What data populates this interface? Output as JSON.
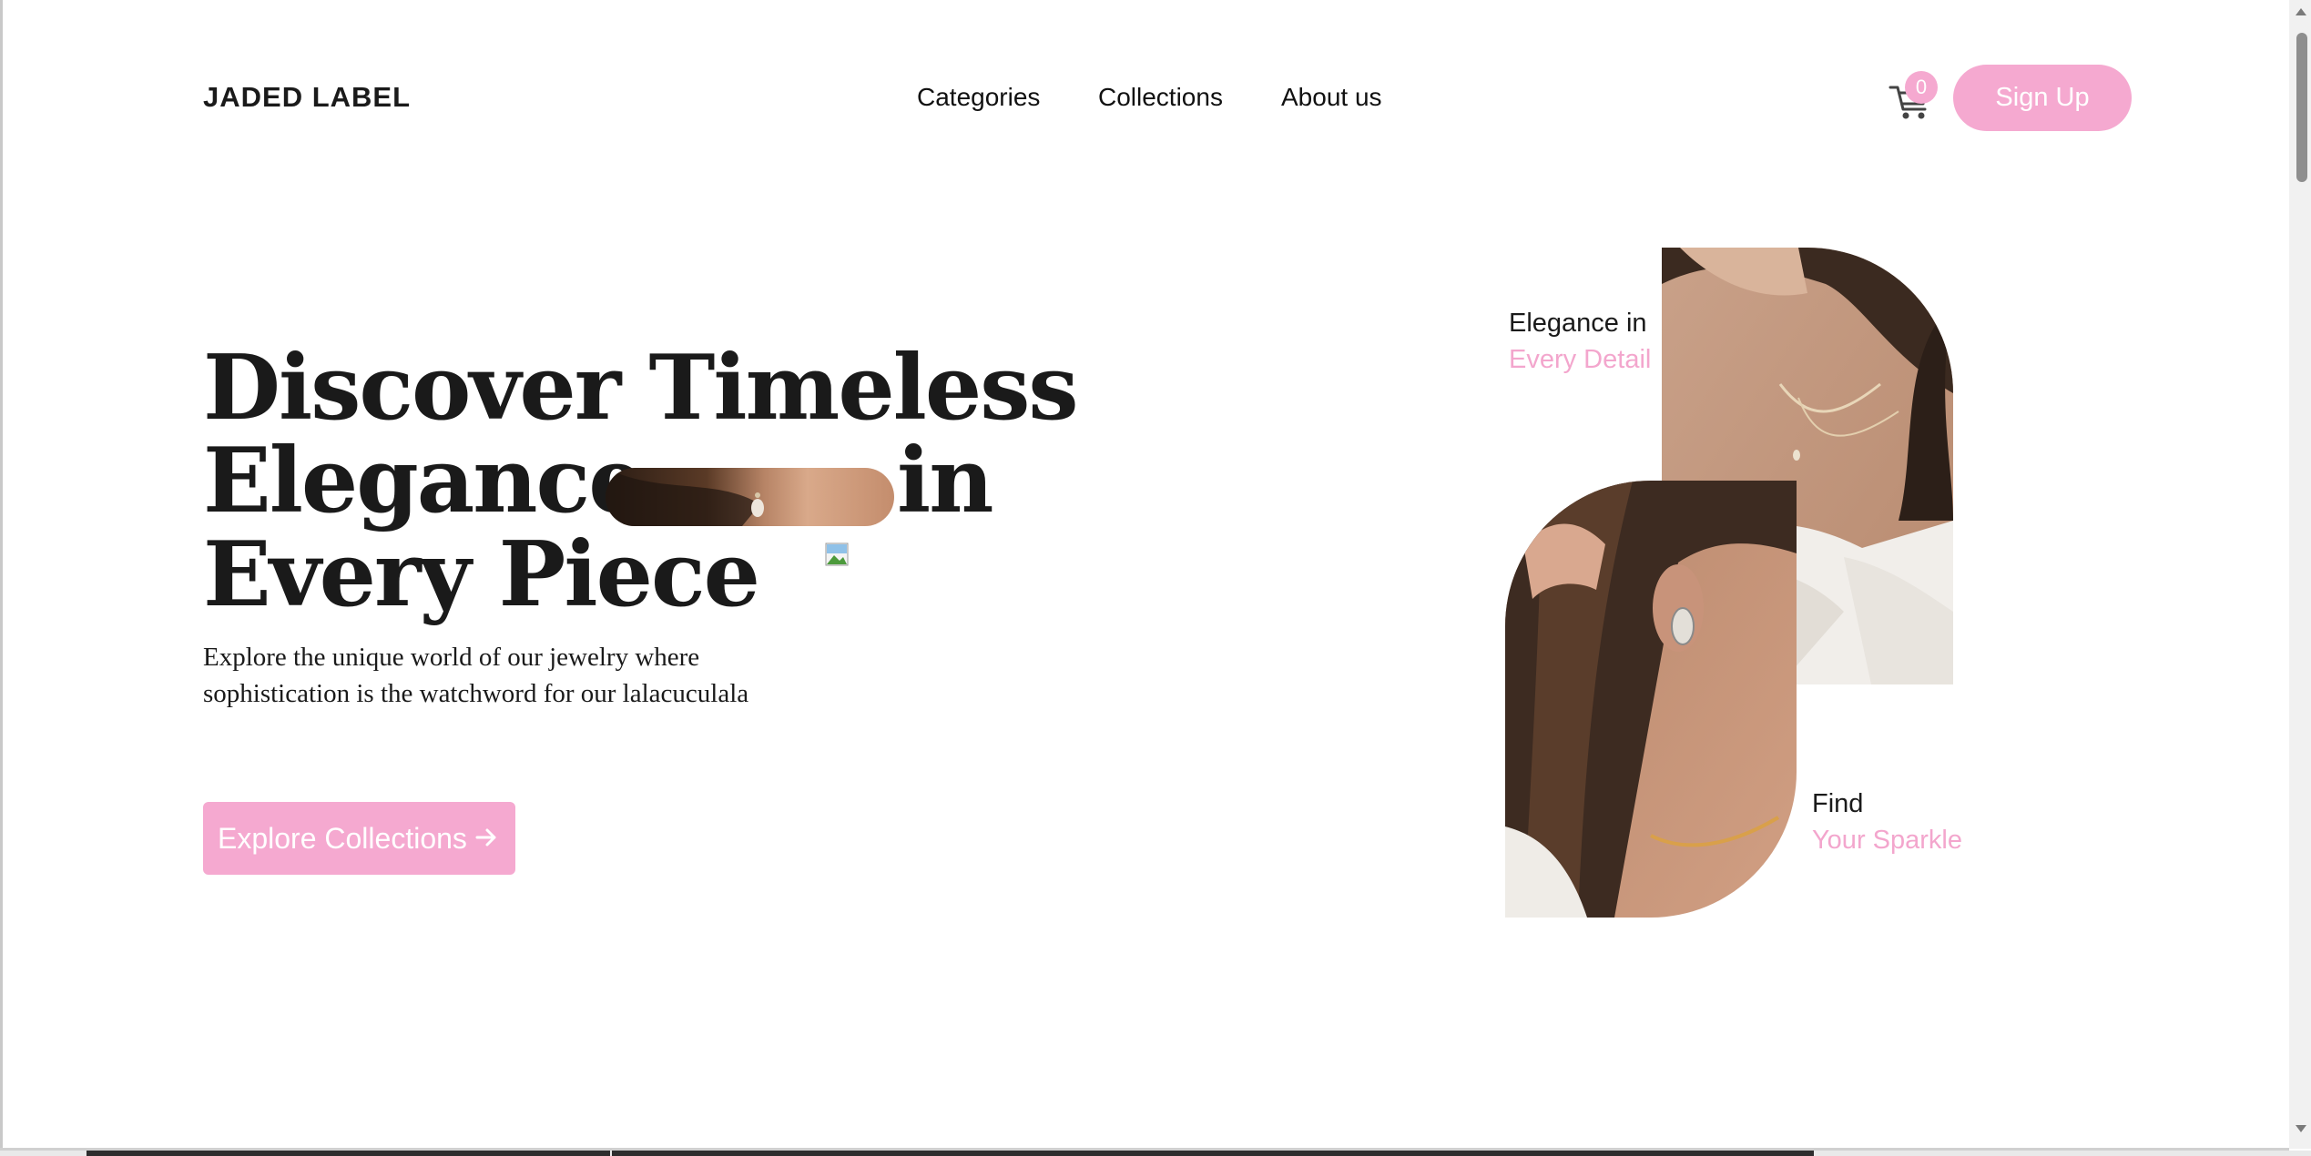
{
  "header": {
    "logo": "JADED LABEL",
    "nav": [
      "Categories",
      "Collections",
      "About us"
    ],
    "cart_count": "0",
    "cart_icon": "cart-icon",
    "signup_label": "Sign Up"
  },
  "hero": {
    "headline_lines": [
      "Discover Timeless",
      "Elegance",
      "in",
      "Every Piece"
    ],
    "description_lines": [
      "Explore the unique world of our jewelry where",
      "sophistication is the watchword for our lalacuculala"
    ],
    "cta_label": "Explore Collections",
    "cta_icon": "arrow-right-icon"
  },
  "gallery": {
    "caption_top": {
      "line1": "Elegance in",
      "line2": "Every Detail"
    },
    "caption_bottom": {
      "line1": "Find",
      "line2": "Your Sparkle"
    }
  },
  "colors": {
    "accent": "#f5a9d0",
    "accent_text": "#f3a6cd",
    "text": "#1a1a1a",
    "background": "#ffffff"
  }
}
